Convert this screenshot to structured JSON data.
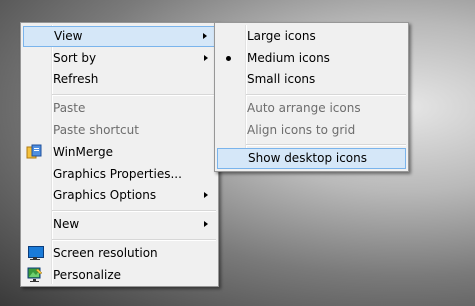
{
  "context_menu": {
    "items": [
      {
        "label": "View",
        "has_submenu": true
      },
      {
        "label": "Sort by",
        "has_submenu": true
      },
      {
        "label": "Refresh"
      },
      {
        "label": "Paste",
        "disabled": true
      },
      {
        "label": "Paste shortcut",
        "disabled": true
      },
      {
        "label": "WinMerge",
        "icon": "winmerge-icon"
      },
      {
        "label": "Graphics Properties..."
      },
      {
        "label": "Graphics Options",
        "has_submenu": true
      },
      {
        "label": "New",
        "has_submenu": true
      },
      {
        "label": "Screen resolution",
        "icon": "screen-resolution-icon"
      },
      {
        "label": "Personalize",
        "icon": "personalize-icon"
      }
    ]
  },
  "view_submenu": {
    "items": [
      {
        "label": "Large icons"
      },
      {
        "label": "Medium icons",
        "selected": true
      },
      {
        "label": "Small icons"
      },
      {
        "label": "Auto arrange icons",
        "disabled": true
      },
      {
        "label": "Align icons to grid",
        "disabled": true
      },
      {
        "label": "Show desktop icons",
        "highlighted": true
      }
    ]
  },
  "colors": {
    "menu_background": "#f0f0f0",
    "highlight_fill": "#d5e7f8",
    "highlight_border": "#7ab4ec",
    "disabled_text": "#6d6d6d"
  }
}
